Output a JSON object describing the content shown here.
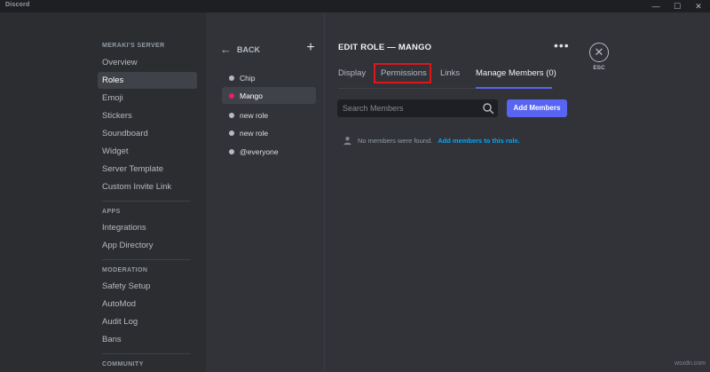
{
  "window": {
    "app_title": "Discord",
    "controls": {
      "minimize": "—",
      "maximize": "☐",
      "close": "✕"
    }
  },
  "sidebar": {
    "server_section": "MERAKI'S SERVER",
    "server_items": [
      {
        "label": "Overview"
      },
      {
        "label": "Roles",
        "selected": true
      },
      {
        "label": "Emoji"
      },
      {
        "label": "Stickers"
      },
      {
        "label": "Soundboard"
      },
      {
        "label": "Widget"
      },
      {
        "label": "Server Template"
      },
      {
        "label": "Custom Invite Link"
      }
    ],
    "apps_section": "APPS",
    "apps_items": [
      {
        "label": "Integrations"
      },
      {
        "label": "App Directory"
      }
    ],
    "moderation_section": "MODERATION",
    "moderation_items": [
      {
        "label": "Safety Setup"
      },
      {
        "label": "AutoMod"
      },
      {
        "label": "Audit Log"
      },
      {
        "label": "Bans"
      }
    ],
    "community_section": "COMMUNITY"
  },
  "roles_panel": {
    "back_label": "BACK",
    "add_icon": "plus-icon",
    "roles": [
      {
        "name": "Chip",
        "color": "#b5bac1"
      },
      {
        "name": "Mango",
        "color": "#e91e63",
        "selected": true
      },
      {
        "name": "new role",
        "color": "#b5bac1"
      },
      {
        "name": "new role",
        "color": "#b5bac1"
      },
      {
        "name": "@everyone",
        "color": "#b5bac1"
      }
    ]
  },
  "edit_role": {
    "title": "EDIT ROLE — MANGO",
    "more_icon": "more-horizontal-icon",
    "esc_label": "ESC",
    "tabs": [
      {
        "label": "Display"
      },
      {
        "label": "Permissions",
        "highlighted": true
      },
      {
        "label": "Links"
      },
      {
        "label": "Manage Members (0)",
        "active": true
      }
    ],
    "search": {
      "placeholder": "Search Members",
      "value": ""
    },
    "add_members_label": "Add Members",
    "empty_message": "No members were found.",
    "empty_link": "Add members to this role."
  },
  "watermark": "wsxdn.com",
  "colors": {
    "accent": "#5865f2",
    "highlight_box": "#e2151a",
    "link": "#00a8fc",
    "background": "#313338",
    "sidebar": "#2b2d31"
  }
}
